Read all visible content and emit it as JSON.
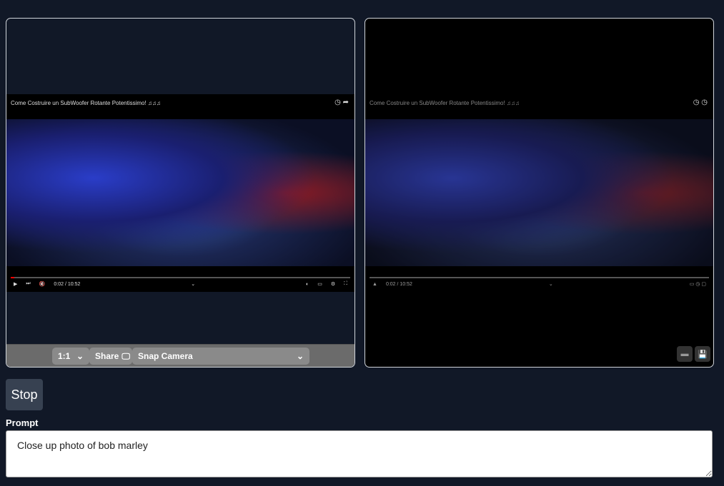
{
  "left_video": {
    "title": "Come Costruire un SubWoofer Rotante Potentissimo! ♫♫♫",
    "time": "0:02 / 10:52",
    "progress_percent": 1
  },
  "right_video": {
    "title": "Come Costruire un SubWoofer Rotante Potentissimo! ♫♫♫",
    "time": "0:02 / 10:52"
  },
  "toolbar": {
    "ratio": "1:1",
    "share": "Share",
    "camera": "Snap Camera"
  },
  "stop_label": "Stop",
  "prompt": {
    "label": "Prompt",
    "value": "Close up photo of bob marley"
  },
  "colors": {
    "background": "#111827",
    "button": "#374151"
  }
}
